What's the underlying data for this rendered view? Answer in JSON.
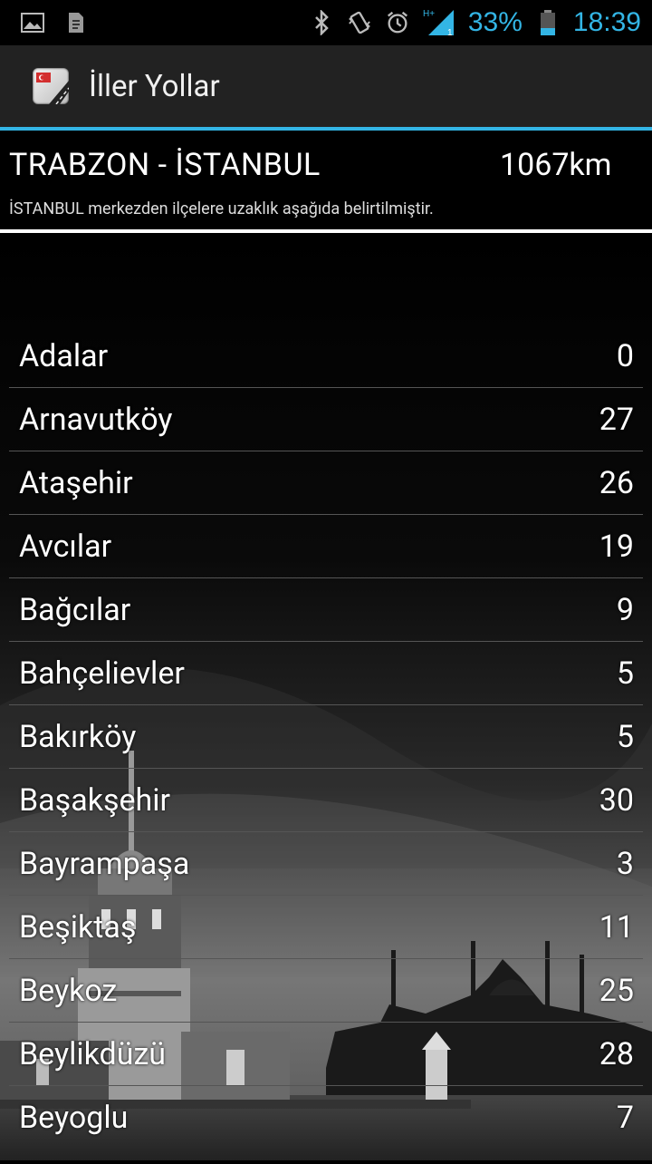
{
  "status_bar": {
    "battery_percent": "33%",
    "time": "18:39",
    "network": "H+",
    "icons": [
      "image-icon",
      "file-icon",
      "bluetooth-icon",
      "vibrate-icon",
      "alarm-icon",
      "signal-icon",
      "battery-icon"
    ]
  },
  "action_bar": {
    "title": "İller Yollar"
  },
  "route": {
    "title": "TRABZON - İSTANBUL",
    "distance": "1067km",
    "subtitle": "İSTANBUL merkezden ilçelere uzaklık aşağıda belirtilmiştir."
  },
  "districts": [
    {
      "name": "Adalar",
      "distance": "0"
    },
    {
      "name": "Arnavutköy",
      "distance": "27"
    },
    {
      "name": "Ataşehir",
      "distance": "26"
    },
    {
      "name": "Avcılar",
      "distance": "19"
    },
    {
      "name": "Bağcılar",
      "distance": "9"
    },
    {
      "name": "Bahçelievler",
      "distance": "5"
    },
    {
      "name": "Bakırköy",
      "distance": "5"
    },
    {
      "name": "Başakşehir",
      "distance": "30"
    },
    {
      "name": "Bayrampaşa",
      "distance": "3"
    },
    {
      "name": "Beşiktaş",
      "distance": "11"
    },
    {
      "name": "Beykoz",
      "distance": "25"
    },
    {
      "name": "Beylikdüzü",
      "distance": "28"
    },
    {
      "name": "Beyoglu",
      "distance": "7"
    }
  ],
  "colors": {
    "accent": "#33b5e5",
    "action_bar_bg": "#222222",
    "background": "#000000"
  }
}
